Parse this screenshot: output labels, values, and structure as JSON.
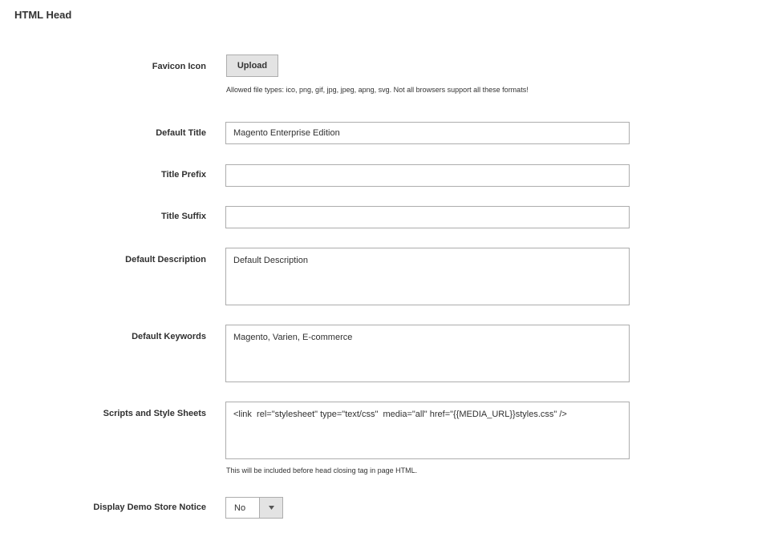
{
  "section": {
    "title": "HTML Head"
  },
  "favicon": {
    "label": "Favicon Icon",
    "button": "Upload",
    "note": "Allowed file types: ico, png, gif, jpg, jpeg, apng, svg. Not all browsers support all these formats!"
  },
  "default_title": {
    "label": "Default Title",
    "value": "Magento Enterprise Edition"
  },
  "title_prefix": {
    "label": "Title Prefix",
    "value": ""
  },
  "title_suffix": {
    "label": "Title Suffix",
    "value": ""
  },
  "default_description": {
    "label": "Default Description",
    "value": "Default Description"
  },
  "default_keywords": {
    "label": "Default Keywords",
    "value": "Magento, Varien, E-commerce"
  },
  "scripts": {
    "label": "Scripts and Style Sheets",
    "value": "<link  rel=\"stylesheet\" type=\"text/css\"  media=\"all\" href=\"{{MEDIA_URL}}styles.css\" />",
    "note": "This will be included before head closing tag in page HTML."
  },
  "demo_notice": {
    "label": "Display Demo Store Notice",
    "value": "No",
    "arrow_icon": "chevron-down-icon"
  }
}
